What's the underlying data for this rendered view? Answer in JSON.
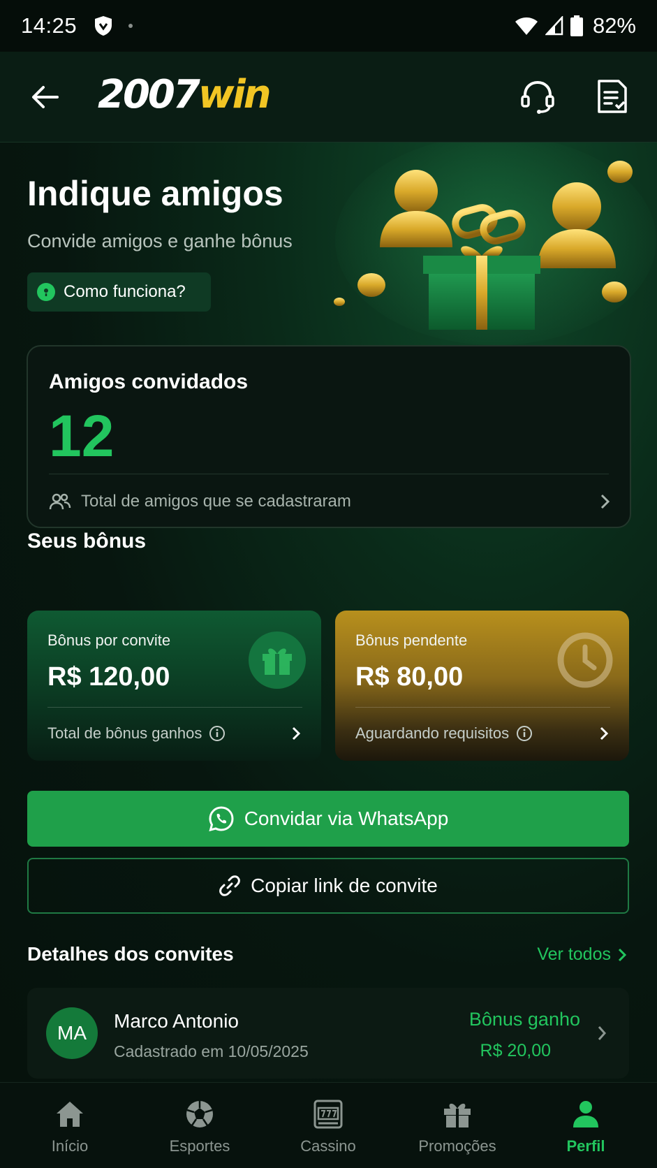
{
  "status_bar": {
    "time": "14:25",
    "battery": "82%"
  },
  "header": {
    "logo_number": "2007",
    "logo_word": "win"
  },
  "hero": {
    "title": "Indique amigos",
    "subtitle": "Convide amigos e ganhe bônus",
    "how_it_works": "Como funciona?"
  },
  "invited_card": {
    "label": "Amigos convidados",
    "count": "12",
    "footer": "Total de amigos que se cadastraram"
  },
  "bonus_section": {
    "title": "Seus bônus"
  },
  "bonus_cards": [
    {
      "title": "Bônus por convite",
      "amount": "R$ 120,00",
      "footer": "Total de bônus ganhos"
    },
    {
      "title": "Bônus pendente",
      "amount": "R$ 80,00",
      "footer": "Aguardando requisitos"
    }
  ],
  "actions": {
    "whatsapp": "Convidar via WhatsApp",
    "copy_link": "Copiar link de convite"
  },
  "details": {
    "title": "Detalhes dos convites",
    "see_all": "Ver todos",
    "items": [
      {
        "initials": "MA",
        "name": "Marco Antonio",
        "date": "Cadastrado em 10/05/2025",
        "bonus_label": "Bônus ganho",
        "bonus_value": "R$ 20,00"
      }
    ]
  },
  "bottom_nav": [
    {
      "label": "Início",
      "icon": "home-icon"
    },
    {
      "label": "Esportes",
      "icon": "soccer-ball-icon"
    },
    {
      "label": "Cassino",
      "icon": "slot-machine-icon"
    },
    {
      "label": "Promoções",
      "icon": "gift-icon"
    },
    {
      "label": "Perfil",
      "icon": "person-icon",
      "active": true
    }
  ],
  "colors": {
    "accent_green": "#22c55e",
    "whatsapp_button": "#1fa04a",
    "brand_gold": "#f2c524",
    "background": "#07130d"
  }
}
